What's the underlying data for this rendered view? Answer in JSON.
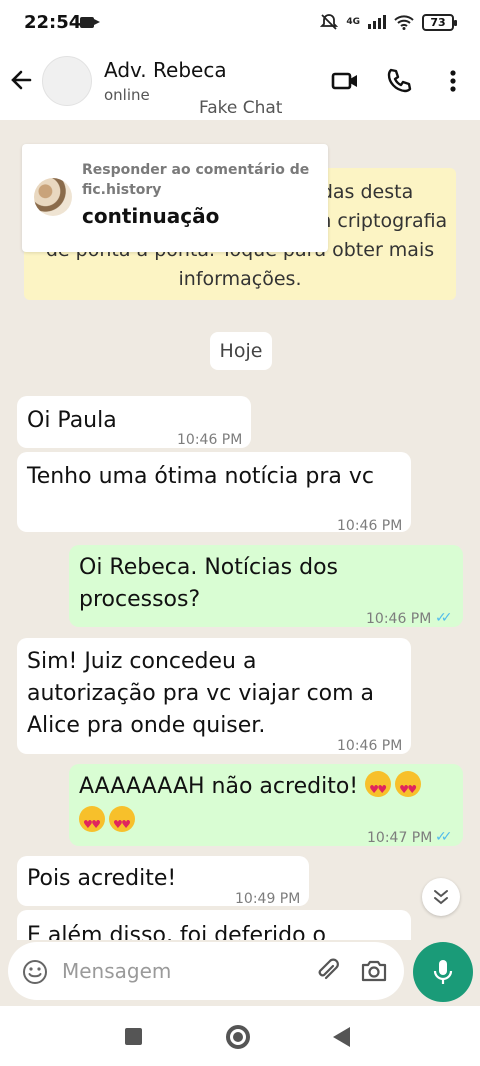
{
  "status_bar": {
    "time": "22:54",
    "network": "4G",
    "battery": "73"
  },
  "header": {
    "contact_name": "Adv. Rebeca",
    "contact_status": "online",
    "overlay_label": "Fake Chat"
  },
  "encryption_notice": "As mensagens e as chamadas desta conversa estão protegidas com criptografia de ponta a ponta. Toque para obter mais informações.",
  "reply_overlay": {
    "title": "Responder ao comentário de fic.history",
    "body": "continuação"
  },
  "date_chip": "Hoje",
  "messages": [
    {
      "dir": "in",
      "text": "Oi Paula",
      "time": "10:46 PM"
    },
    {
      "dir": "in",
      "text": "Tenho uma ótima notícia pra vc",
      "time": "10:46 PM"
    },
    {
      "dir": "out",
      "line1": "Oi Rebeca. Notícias dos",
      "line2": "processos?",
      "time": "10:46 PM",
      "status": "read"
    },
    {
      "dir": "in",
      "line1": "Sim! Juiz concedeu a",
      "line2": "autorização pra vc viajar com a",
      "line3": "Alice pra onde quiser.",
      "time": "10:46 PM"
    },
    {
      "dir": "out",
      "text": "AAAAAAAH não acredito!",
      "time": "10:47 PM",
      "status": "read",
      "emoji": "smiling-face-with-heart-eyes"
    },
    {
      "dir": "in",
      "text": "Pois acredite!",
      "time": "10:49 PM"
    },
    {
      "dir": "in",
      "text": "E além disso, foi deferido o",
      "time": ""
    }
  ],
  "input": {
    "placeholder": "Mensagem"
  },
  "colors": {
    "out_bubble": "#d9fdd3",
    "in_bubble": "#ffffff",
    "chat_bg": "#efeae2",
    "accent": "#1a9b78",
    "read_ticks": "#53bdeb"
  }
}
